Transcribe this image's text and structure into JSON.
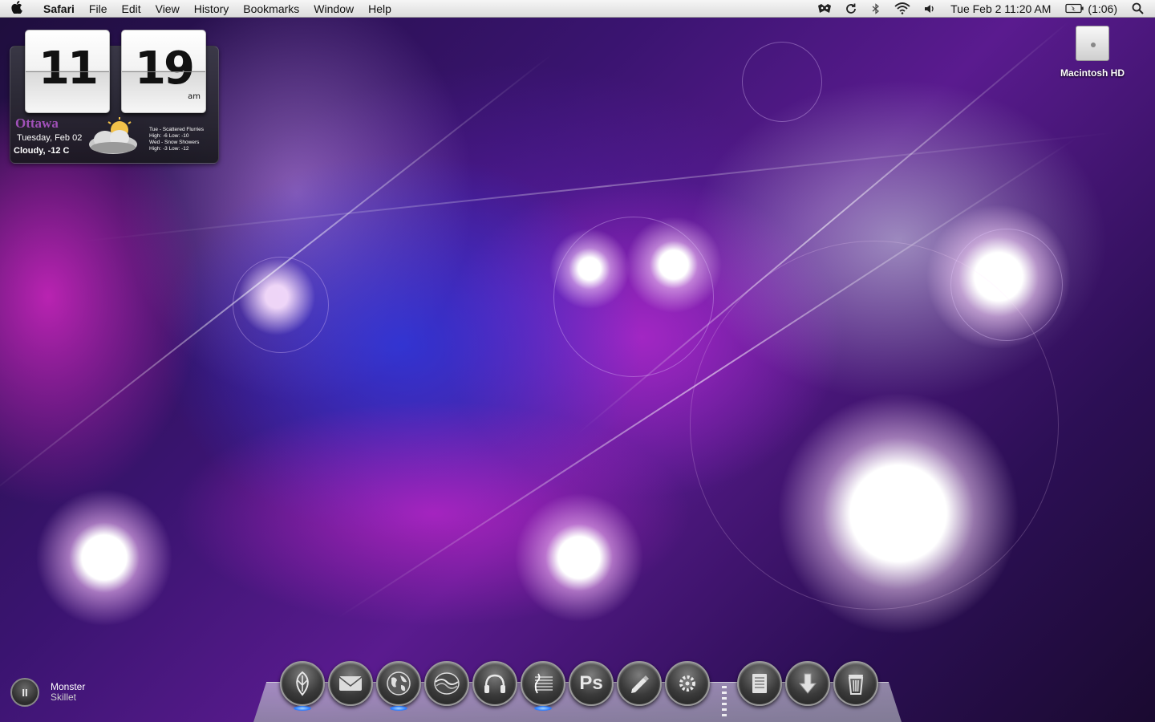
{
  "menubar": {
    "apple_icon": "apple-icon",
    "app_name": "Safari",
    "menus": [
      "File",
      "Edit",
      "View",
      "History",
      "Bookmarks",
      "Window",
      "Help"
    ],
    "status_icons": [
      "growl-icon",
      "sync-icon",
      "bluetooth-icon",
      "wifi-icon",
      "volume-icon"
    ],
    "clock": "Tue Feb 2  11:20 AM",
    "battery_time": "(1:06)",
    "spotlight_icon": "spotlight-icon"
  },
  "clock_widget": {
    "hour": "11",
    "minute": "19",
    "ampm": "am",
    "city": "Ottawa",
    "date": "Tuesday, Feb 02",
    "current": "Cloudy, -12 C",
    "weather_icon": "cloudy-sun-icon",
    "forecast": [
      "Tue - Scattered Flurries",
      "High: -6 Low: -10",
      "Wed - Snow Showers",
      "High: -3 Low: -12"
    ]
  },
  "desktop": {
    "drive_label": "Macintosh HD"
  },
  "now_playing": {
    "button_glyph": "II",
    "track": "Monster",
    "artist": "Skillet"
  },
  "dock": {
    "items": [
      {
        "name": "feather-app-icon",
        "running": true
      },
      {
        "name": "mail-icon",
        "running": false
      },
      {
        "name": "globe-icon",
        "running": true
      },
      {
        "name": "wave-app-icon",
        "running": false
      },
      {
        "name": "headphones-icon",
        "running": false
      },
      {
        "name": "music-notes-icon",
        "running": true
      },
      {
        "name": "photoshop-icon",
        "label": "Ps",
        "running": false
      },
      {
        "name": "pencil-icon",
        "running": false
      },
      {
        "name": "gear-icon",
        "running": false
      },
      {
        "name": "documents-icon",
        "running": false
      },
      {
        "name": "downloads-icon",
        "running": false
      },
      {
        "name": "trash-icon",
        "running": false
      }
    ]
  },
  "colors": {
    "menubar": "#e8e8e8",
    "city_label": "#a050b8",
    "running_indicator": "#2a7cff",
    "wallpaper_base": "#3a1470"
  }
}
